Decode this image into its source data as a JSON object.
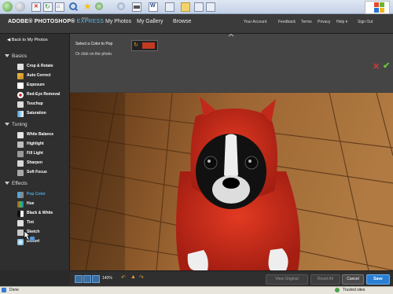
{
  "browser": {
    "buttons": [
      "back",
      "forward",
      "stop",
      "refresh",
      "home",
      "search",
      "favorites",
      "history",
      "mail",
      "print",
      "edit",
      "discuss",
      "folders"
    ]
  },
  "header": {
    "logo_main": "ADOBE® PHOTOSHOP®",
    "logo_express": "EXPRESS",
    "logo_beta": "BETA",
    "nav": [
      "My Photos",
      "My Gallery",
      "Browse"
    ],
    "util": [
      "Your Account",
      "Feedback",
      "Terms",
      "Privacy",
      "Help ▾",
      "Sign Out"
    ]
  },
  "sidebar": {
    "back_label": "◀ Back to My Photos",
    "sections": [
      {
        "title": "Basics",
        "items": [
          "Crop & Rotate",
          "Auto Correct",
          "Exposure",
          "Red-Eye Removal",
          "Touchup",
          "Saturation"
        ]
      },
      {
        "title": "Tuning",
        "items": [
          "White Balance",
          "Highlight",
          "Fill Light",
          "Sharpen",
          "Soft Focus"
        ]
      },
      {
        "title": "Effects",
        "items": [
          "Pop Color",
          "Hue",
          "Black & White",
          "Tint",
          "Sketch",
          "Distort"
        ]
      }
    ],
    "active_item": "Pop Color"
  },
  "toolbar": {
    "select_text": "Select a Color to Pop",
    "click_text": "Or click on the photo.",
    "selected_color": "#c23a22"
  },
  "footer": {
    "zoom": "140%",
    "view_original": "View Original",
    "reset_all": "Reset All",
    "cancel": "Cancel",
    "save": "Save"
  },
  "status": {
    "left": "Done",
    "right": "Trusted sites"
  },
  "colors": {
    "accent": "#4da8dd",
    "save_button": "#2a7fd4",
    "cancel_x": "#d43a3a",
    "ok_check": "#6bc33a"
  }
}
